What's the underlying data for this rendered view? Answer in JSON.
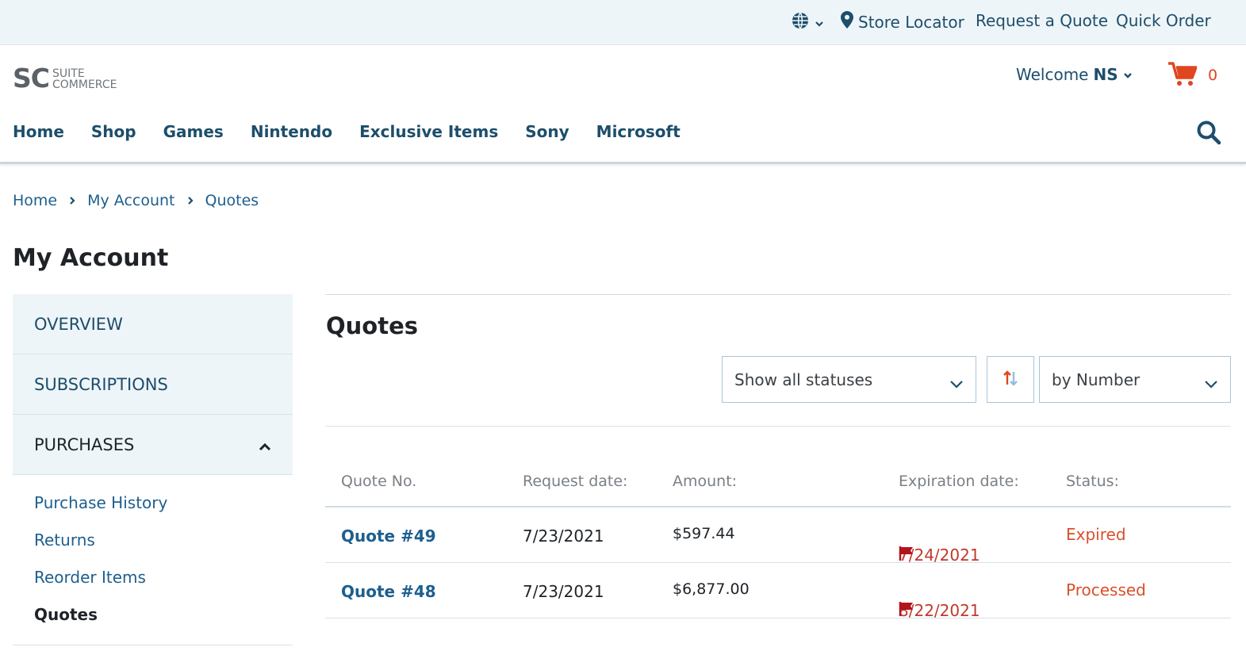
{
  "topbar": {
    "store_locator": "Store Locator",
    "request_quote": "Request a Quote",
    "quick_order": "Quick Order"
  },
  "header": {
    "logo_main": "SC",
    "logo_sub1": "SUITE",
    "logo_sub2": "COMMERCE",
    "welcome_prefix": "Welcome",
    "welcome_user": "NS",
    "cart_count": "0",
    "nav": [
      "Home",
      "Shop",
      "Games",
      "Nintendo",
      "Exclusive Items",
      "Sony",
      "Microsoft"
    ]
  },
  "breadcrumb": [
    "Home",
    "My Account",
    "Quotes"
  ],
  "page_title": "My Account",
  "sidebar": {
    "overview": "OVERVIEW",
    "subscriptions": "SUBSCRIPTIONS",
    "purchases": "PURCHASES",
    "links": [
      "Purchase History",
      "Returns",
      "Reorder Items",
      "Quotes"
    ]
  },
  "main": {
    "title": "Quotes",
    "status_filter": "Show all statuses",
    "sort_by": "by Number",
    "columns": [
      "Quote No.",
      "Request date:",
      "Amount:",
      "Expiration date:",
      "Status:"
    ],
    "rows": [
      {
        "quote": "Quote #49",
        "request_date": "7/23/2021",
        "amount": "$597.44",
        "expiration": "7/24/2021",
        "status": "Expired"
      },
      {
        "quote": "Quote #48",
        "request_date": "7/23/2021",
        "amount": "$6,877.00",
        "expiration": "8/22/2021",
        "status": "Processed"
      }
    ]
  },
  "colors": {
    "brand_blue": "#1d4e6b",
    "link_blue": "#1d5f8f",
    "accent_orange": "#e0461f",
    "flag_red": "#b3141c"
  }
}
